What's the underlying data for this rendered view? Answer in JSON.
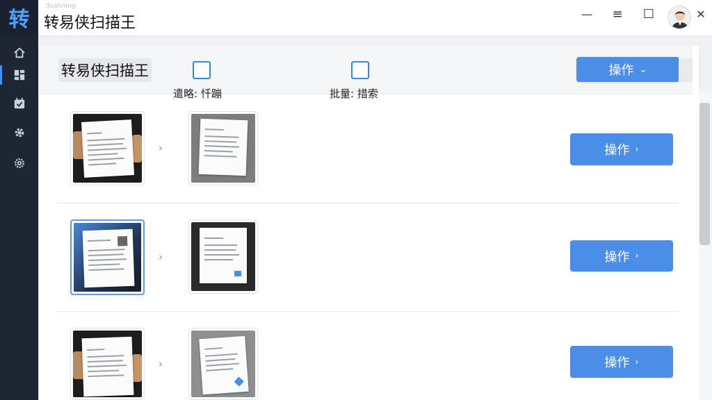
{
  "app": {
    "logo_char": "转",
    "title": "转易侠扫描王",
    "subtitle": "Scanning"
  },
  "sidebar": {
    "items": [
      {
        "name": "home",
        "icon": "home-icon",
        "active": false
      },
      {
        "name": "dashboard",
        "icon": "grid-icon",
        "active": true
      },
      {
        "name": "tasks",
        "icon": "check-calendar-icon",
        "active": false
      },
      {
        "name": "tools",
        "icon": "gear-icon",
        "active": false
      },
      {
        "name": "settings",
        "icon": "settings-icon",
        "active": false
      }
    ]
  },
  "window_controls": {
    "minimize": "—",
    "menu": "≡",
    "maximize": "☐",
    "close": "✕"
  },
  "header": {
    "title": "转易侠扫描王",
    "checkbox1_label": "遣略: 忏蹦",
    "checkbox2_label": "批量: 措索",
    "action_button": "操作",
    "action_chevron": "⌄"
  },
  "rows": [
    {
      "button": "操作",
      "chevron": "›",
      "arrow": "›"
    },
    {
      "button": "操作",
      "chevron": "›",
      "arrow": "›"
    },
    {
      "button": "操作",
      "chevron": "›",
      "arrow": "›"
    }
  ],
  "colors": {
    "sidebar_bg": "#1e2633",
    "accent": "#4a8ee8",
    "logo": "#4fa3ff"
  }
}
